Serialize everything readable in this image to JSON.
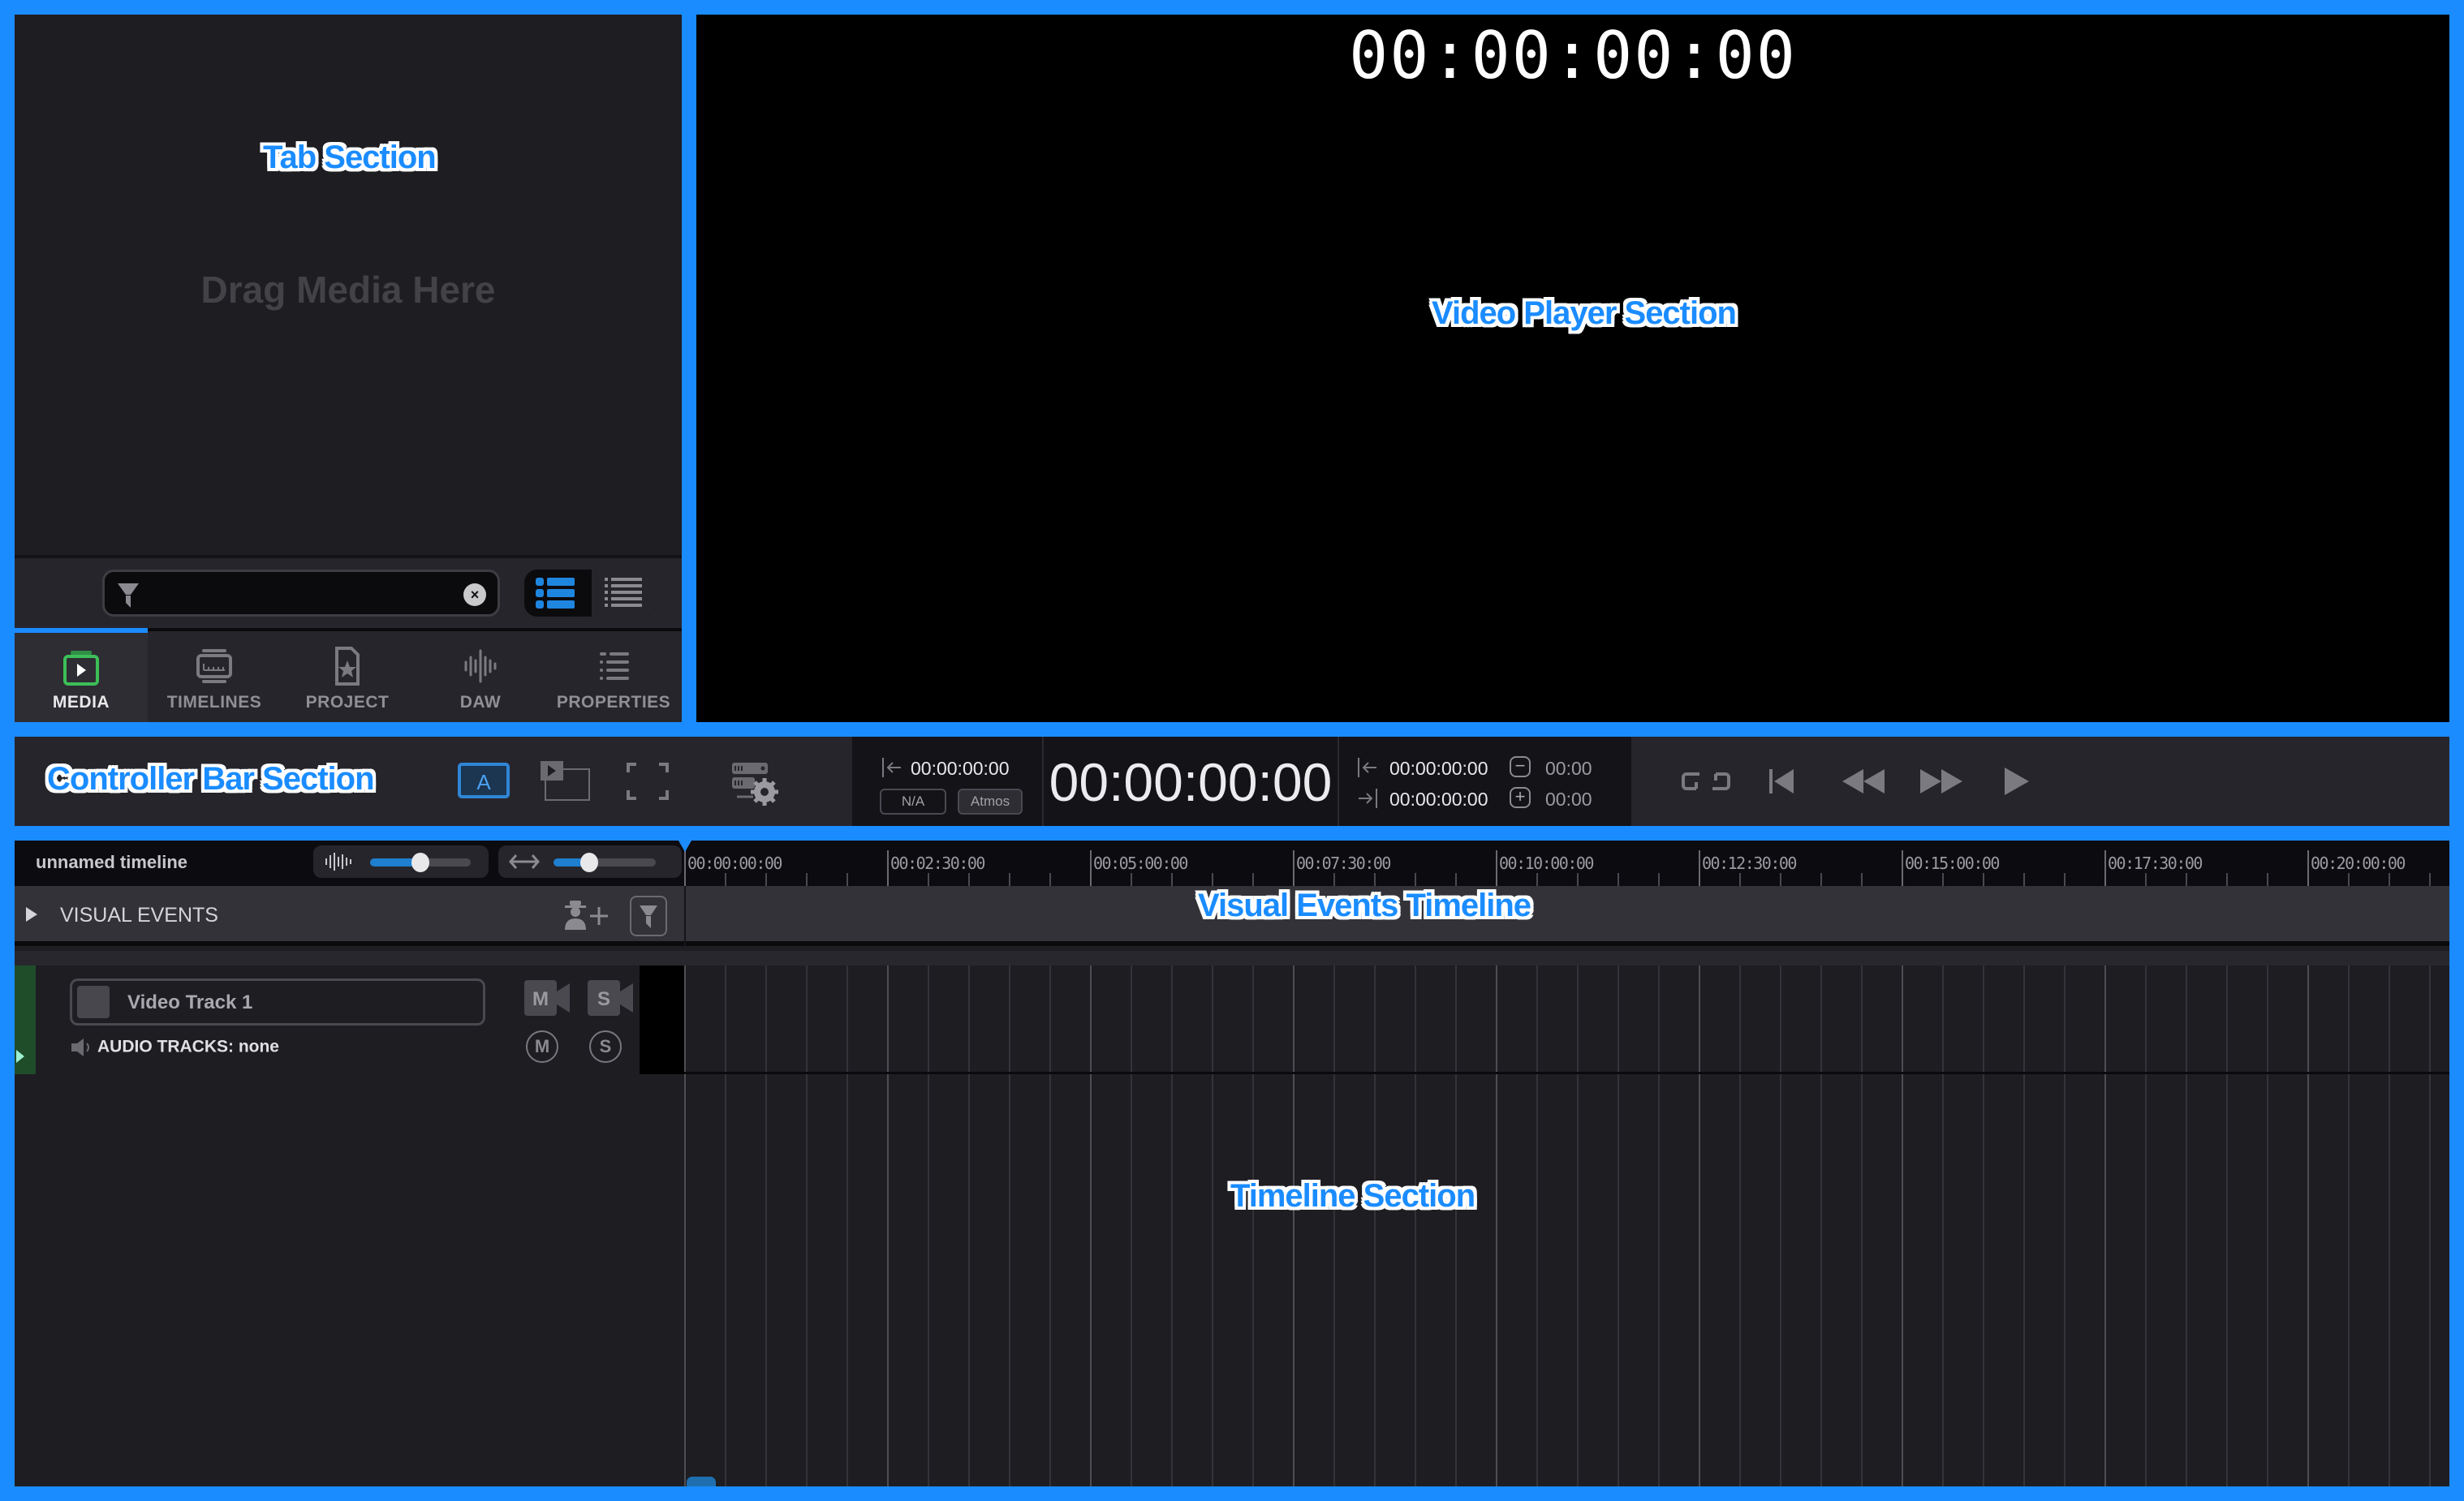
{
  "annotations": {
    "tab_section": "Tab Section",
    "video_player_section": "Video Player Section",
    "controller_bar_section": "Controller Bar Section",
    "visual_events_timeline": "Visual Events Timeline",
    "timeline_section": "Timeline Section"
  },
  "tab_panel": {
    "empty_hint": "Drag Media Here",
    "search": {
      "value": "",
      "placeholder": ""
    },
    "view_modes": [
      {
        "name": "grouped-list",
        "active": true
      },
      {
        "name": "compact-list",
        "active": false
      }
    ],
    "tabs": [
      {
        "label": "MEDIA",
        "icon": "media-icon",
        "active": true
      },
      {
        "label": "TIMELINES",
        "icon": "timelines-icon",
        "active": false
      },
      {
        "label": "PROJECT",
        "icon": "project-icon",
        "active": false
      },
      {
        "label": "DAW",
        "icon": "daw-icon",
        "active": false
      },
      {
        "label": "PROPERTIES",
        "icon": "properties-icon",
        "active": false
      }
    ]
  },
  "player": {
    "timecode": "00:00:00:00"
  },
  "controller": {
    "buttons": [
      "auto-button",
      "picture-in-picture-button",
      "fullscreen-button",
      "server-settings-button"
    ],
    "auto_label": "A",
    "source_in": "00:00:00:00",
    "format_na": "N/A",
    "format_atmos": "Atmos",
    "main_timecode": "00:00:00:00",
    "mark_in": "00:00:00:00",
    "mark_out": "00:00:00:00",
    "offset_minus": "00:00",
    "offset_plus": "00:00",
    "transport": [
      "loop",
      "go-to-start",
      "rewind",
      "fast-forward",
      "play"
    ]
  },
  "timeline": {
    "name": "unnamed timeline",
    "audio_zoom": 0.5,
    "horizontal_zoom": 0.35,
    "ruler_labels": [
      "00:00:00:00",
      "00:02:30:00",
      "00:05:00:00",
      "00:07:30:00",
      "00:10:00:00",
      "00:12:30:00",
      "00:15:00:00",
      "00:17:30:00",
      "00:20:00:00"
    ],
    "visual_events_label": "VISUAL EVENTS",
    "tracks": [
      {
        "name": "Video Track 1",
        "audio_tracks_label": "AUDIO TRACKS: none",
        "mute_label": "M",
        "solo_label": "S"
      }
    ]
  },
  "colors": {
    "accent": "#1a8cff",
    "media_tab_icon": "#3cbf58",
    "track_color": "#1f4d2a"
  }
}
